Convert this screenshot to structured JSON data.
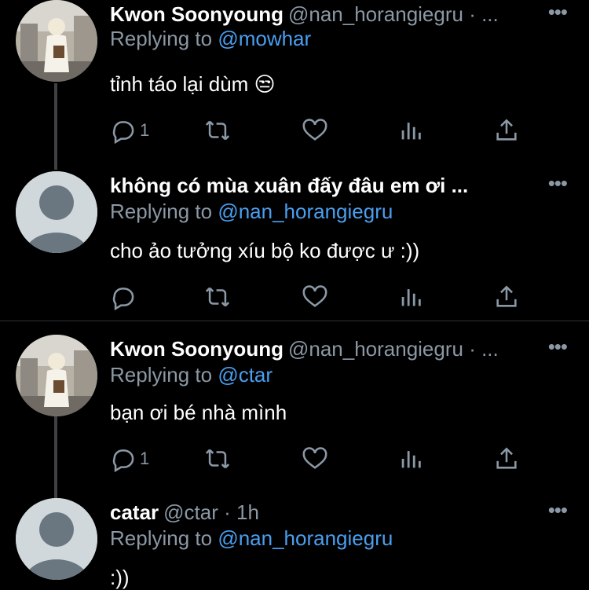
{
  "tweets": [
    {
      "name": "Kwon Soonyoung",
      "handle": "@nan_horangiegru · ...",
      "more": "•••",
      "reply_prefix": "Replying to ",
      "reply_to": "@mowhar",
      "text": "tỉnh táo lại dùm 😒",
      "reply_count": "1",
      "avatar": "photo"
    },
    {
      "name": "không có mùa xuân đấy đâu em ơi ...",
      "handle": "",
      "more": "•••",
      "reply_prefix": "Replying to ",
      "reply_to": "@nan_horangiegru",
      "text": "cho ảo tưởng xíu bộ ko được ư :))",
      "reply_count": "",
      "avatar": "default"
    },
    {
      "name": "Kwon Soonyoung",
      "handle": "@nan_horangiegru · ...",
      "more": "•••",
      "reply_prefix": "Replying to ",
      "reply_to": "@ctar",
      "text": "bạn ơi bé nhà mình",
      "reply_count": "1",
      "avatar": "photo"
    },
    {
      "name": "catar",
      "handle": "@ctar · 1h",
      "more": "•••",
      "reply_prefix": "Replying to ",
      "reply_to": "@nan_horangiegru",
      "text": ":))",
      "reply_count": "",
      "avatar": "default"
    }
  ],
  "icons": [
    "reply-icon",
    "retweet-icon",
    "like-icon",
    "analytics-icon",
    "share-icon",
    "more-icon"
  ],
  "colors": {
    "background": "#000000",
    "secondary_text": "#8b98a5",
    "mention": "#4a9ff0",
    "divider": "#2f3336"
  }
}
